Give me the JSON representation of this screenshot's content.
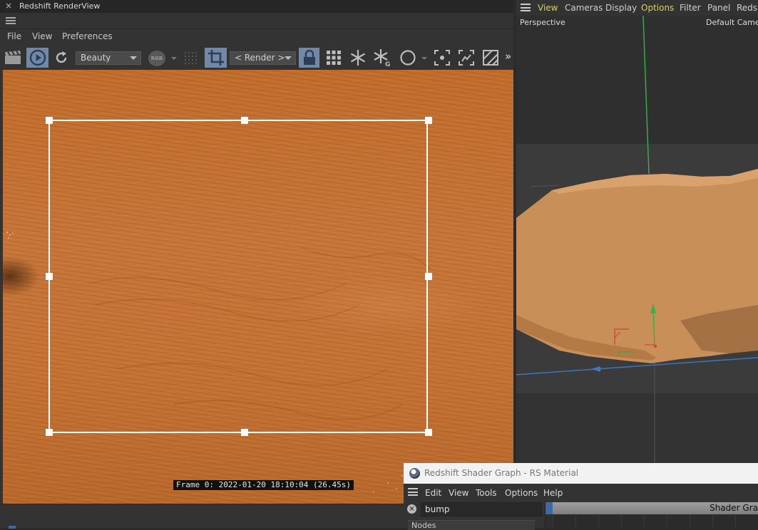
{
  "render_view": {
    "title": "Redshift RenderView",
    "close_glyph": "×",
    "menu": [
      "File",
      "View",
      "Preferences"
    ],
    "aov_dropdown": "Beauty",
    "channel_badge": "RGB",
    "render_dropdown": "< Render >",
    "more_glyph": "»",
    "frame_info": "Frame  0: 2022-01-20  18:10:04  (26.45s)",
    "icons": {
      "clapper": "clapper-icon",
      "play": "play-icon",
      "refresh": "refresh-icon",
      "crop": "crop-region-icon",
      "lock": "lock-icon",
      "grid": "grid-icon",
      "snowflake": "freeze-icon",
      "snowflake_g": "freeze-geometry-icon",
      "circle": "circle-icon"
    },
    "colors": {
      "active_button": "#7089a8",
      "render_surface": "#c4712f"
    }
  },
  "viewport": {
    "menu": [
      "View",
      "Cameras",
      "Display",
      "Options",
      "Filter",
      "Panel",
      "Redsh"
    ],
    "active_menu": "Options",
    "view_label": "Perspective",
    "camera_label": "Default Camer",
    "colors": {
      "active_menu": "#d7cf6a",
      "terrain": "#c98f59"
    }
  },
  "shader_graph": {
    "title": "Redshift Shader Graph - RS Material",
    "menu": [
      "Edit",
      "View",
      "Tools",
      "Options",
      "Help"
    ],
    "search_value": "bump",
    "clear_glyph": "×",
    "nodes_label": "Nodes",
    "graph_tab": "Shader Gra"
  }
}
